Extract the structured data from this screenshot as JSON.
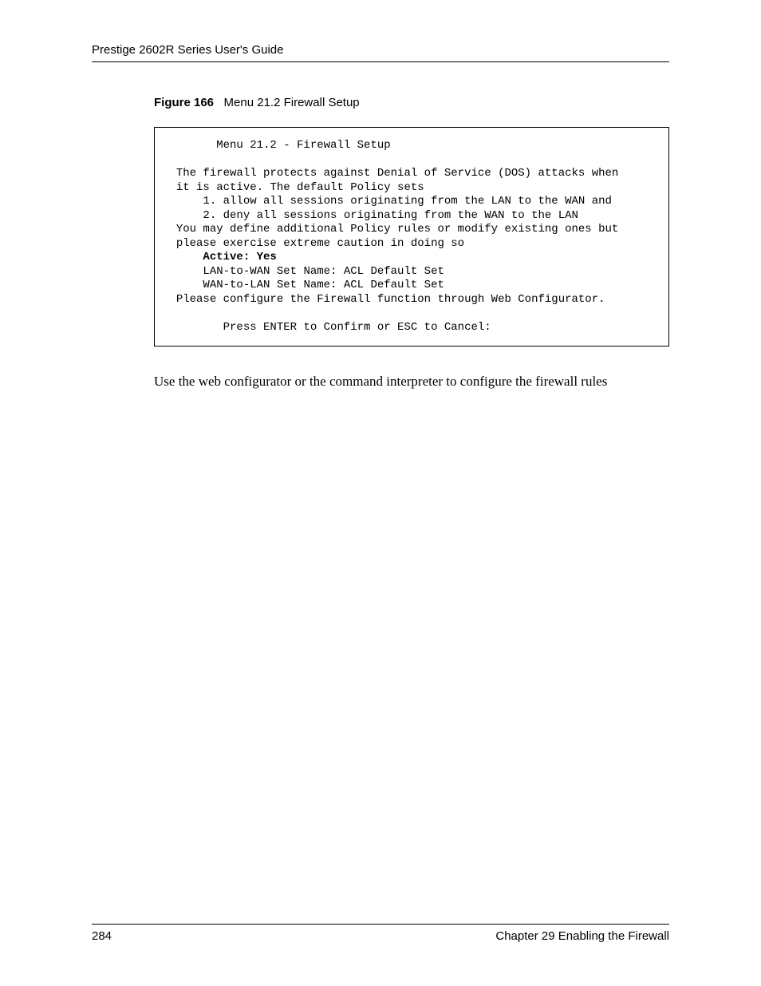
{
  "header": {
    "running_head": "Prestige 2602R Series User's Guide"
  },
  "figure": {
    "label": "Figure 166",
    "title": "Menu 21.2 Firewall Setup"
  },
  "terminal": {
    "menu_title": "Menu 21.2 - Firewall Setup",
    "intro1": "The firewall protects against Denial of Service (DOS) attacks when",
    "intro2": "it is active. The default Policy sets",
    "policy1": "1. allow all sessions originating from the LAN to the WAN and",
    "policy2": "2. deny all sessions originating from the WAN to the LAN",
    "note1": "You may define additional Policy rules or modify existing ones but",
    "note2": "please exercise extreme caution in doing so",
    "active": "Active: Yes",
    "lan_to_wan": "LAN-to-WAN Set Name: ACL Default Set",
    "wan_to_lan": "WAN-to-LAN Set Name: ACL Default Set",
    "config_note": "Please configure the Firewall function through Web Configurator.",
    "prompt": "Press ENTER to Confirm or ESC to Cancel:"
  },
  "body": {
    "text": "Use the web configurator or the command interpreter to configure the firewall rules"
  },
  "footer": {
    "page_number": "284",
    "chapter": "Chapter 29 Enabling the Firewall"
  }
}
